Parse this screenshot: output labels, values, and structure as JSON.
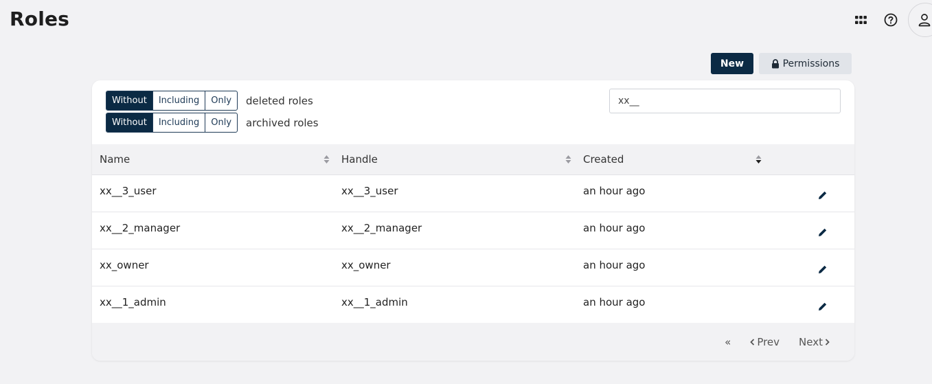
{
  "header": {
    "title": "Roles",
    "icons": [
      "apps-grid-icon",
      "help-icon",
      "user-icon"
    ]
  },
  "actions": {
    "new_label": "New",
    "permissions_label": "Permissions"
  },
  "filters": {
    "deleted": {
      "options": [
        "Without",
        "Including",
        "Only"
      ],
      "selected": "Without",
      "label": "deleted roles"
    },
    "archived": {
      "options": [
        "Without",
        "Including",
        "Only"
      ],
      "selected": "Without",
      "label": "archived roles"
    }
  },
  "search": {
    "value": "xx__"
  },
  "table": {
    "columns": [
      "Name",
      "Handle",
      "Created"
    ],
    "rows": [
      {
        "name": "xx__3_user",
        "handle": "xx__3_user",
        "created": "an hour ago"
      },
      {
        "name": "xx__2_manager",
        "handle": "xx__2_manager",
        "created": "an hour ago"
      },
      {
        "name": "xx_owner",
        "handle": "xx_owner",
        "created": "an hour ago"
      },
      {
        "name": "xx__1_admin",
        "handle": "xx__1_admin",
        "created": "an hour ago"
      }
    ]
  },
  "pagination": {
    "first_label": "«",
    "prev_label": "Prev",
    "next_label": "Next"
  },
  "colors": {
    "primary": "#0b2a44",
    "background": "#f2f2f4",
    "secondary_button": "#e1e4e9"
  }
}
